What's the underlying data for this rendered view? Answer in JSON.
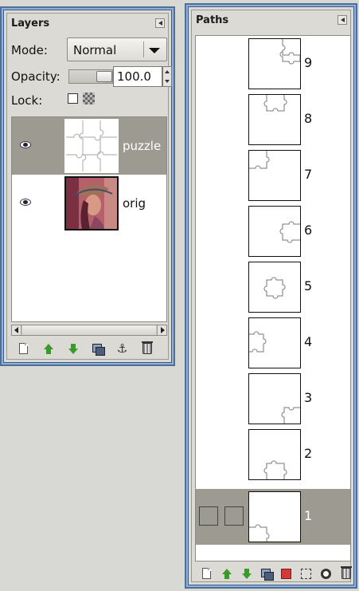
{
  "layers_dock": {
    "title": "Layers",
    "mode_label": "Mode:",
    "mode_value": "Normal",
    "opacity_label": "Opacity:",
    "opacity_value": "100.0",
    "opacity_fraction": 1.0,
    "lock_label": "Lock:",
    "layers": [
      {
        "name": "puzzle",
        "visible": true,
        "selected": true
      },
      {
        "name": "orig",
        "visible": true,
        "selected": false
      }
    ],
    "buttons": [
      "new-layer",
      "raise-layer",
      "lower-layer",
      "duplicate-layer",
      "anchor-layer",
      "delete-layer"
    ]
  },
  "paths_dock": {
    "title": "Paths",
    "paths": [
      {
        "name": "9",
        "selected": false
      },
      {
        "name": "8",
        "selected": false
      },
      {
        "name": "7",
        "selected": false
      },
      {
        "name": "6",
        "selected": false
      },
      {
        "name": "5",
        "selected": false
      },
      {
        "name": "4",
        "selected": false
      },
      {
        "name": "3",
        "selected": false
      },
      {
        "name": "2",
        "selected": false
      },
      {
        "name": "1",
        "selected": true
      }
    ],
    "buttons": [
      "new-path",
      "raise-path",
      "lower-path",
      "duplicate-path",
      "path-to-selection",
      "selection-to-path",
      "stroke-path",
      "delete-path"
    ]
  },
  "colors": {
    "selection": "#9d9a92",
    "frame": "#4f6f98",
    "panel_bg": "#dcdad5"
  }
}
